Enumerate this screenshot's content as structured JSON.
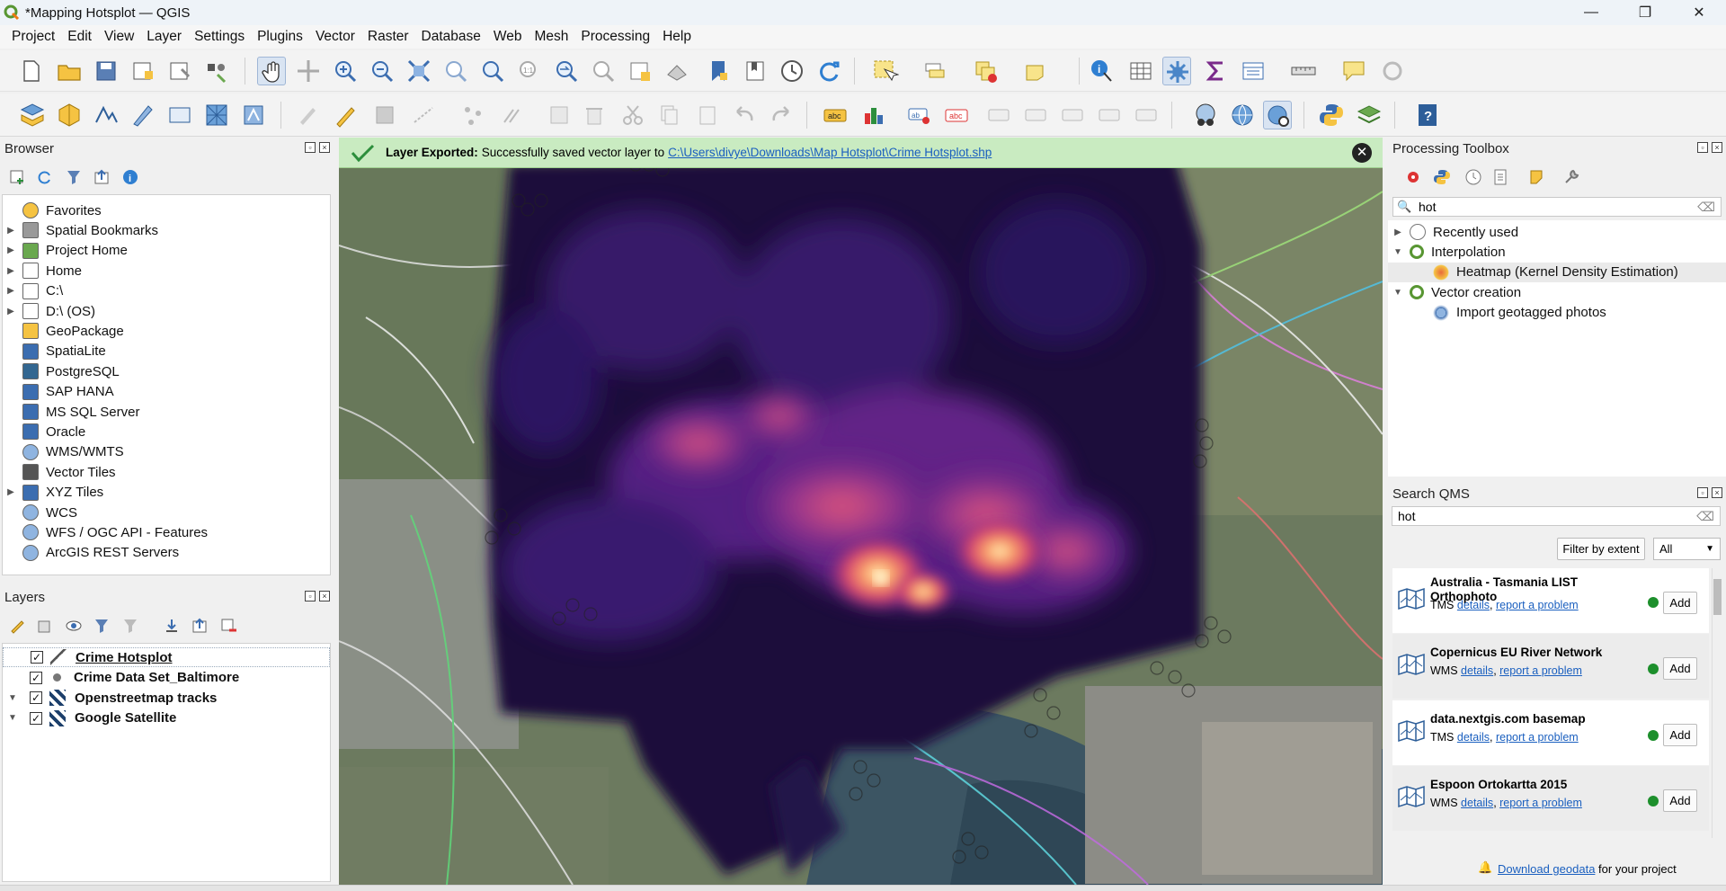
{
  "window": {
    "title": "*Mapping Hotsplot — QGIS",
    "minimize": "—",
    "maximize": "❐",
    "close": "✕"
  },
  "menu": [
    "Project",
    "Edit",
    "View",
    "Layer",
    "Settings",
    "Plugins",
    "Vector",
    "Raster",
    "Database",
    "Web",
    "Mesh",
    "Processing",
    "Help"
  ],
  "browser": {
    "title": "Browser",
    "items": [
      {
        "label": "Favorites",
        "icon": "star-icon",
        "expandable": false
      },
      {
        "label": "Spatial Bookmarks",
        "icon": "bookmark-icon",
        "expandable": true
      },
      {
        "label": "Project Home",
        "icon": "project-home-icon",
        "expandable": true
      },
      {
        "label": "Home",
        "icon": "home-icon",
        "expandable": true
      },
      {
        "label": "C:\\",
        "icon": "drive-icon",
        "expandable": true
      },
      {
        "label": "D:\\ (OS)",
        "icon": "drive-icon",
        "expandable": true
      },
      {
        "label": "GeoPackage",
        "icon": "geopackage-icon",
        "expandable": false
      },
      {
        "label": "SpatiaLite",
        "icon": "spatialite-icon",
        "expandable": false
      },
      {
        "label": "PostgreSQL",
        "icon": "postgresql-icon",
        "expandable": false
      },
      {
        "label": "SAP HANA",
        "icon": "sap-hana-icon",
        "expandable": false
      },
      {
        "label": "MS SQL Server",
        "icon": "mssql-icon",
        "expandable": false
      },
      {
        "label": "Oracle",
        "icon": "oracle-icon",
        "expandable": false
      },
      {
        "label": "WMS/WMTS",
        "icon": "wms-icon",
        "expandable": false
      },
      {
        "label": "Vector Tiles",
        "icon": "vector-tiles-icon",
        "expandable": false
      },
      {
        "label": "XYZ Tiles",
        "icon": "xyz-tiles-icon",
        "expandable": true
      },
      {
        "label": "WCS",
        "icon": "wcs-icon",
        "expandable": false
      },
      {
        "label": "WFS / OGC API - Features",
        "icon": "wfs-icon",
        "expandable": false
      },
      {
        "label": "ArcGIS REST Servers",
        "icon": "arcgis-icon",
        "expandable": false
      }
    ]
  },
  "layers": {
    "title": "Layers",
    "items": [
      {
        "label": "Crime Hotsplot",
        "checked": true,
        "icon": "raster-layer-icon",
        "selected": true,
        "expandable": false
      },
      {
        "label": "Crime Data Set_Baltimore",
        "checked": true,
        "icon": "point-layer-icon",
        "selected": false,
        "expandable": false
      },
      {
        "label": "Openstreetmap tracks",
        "checked": true,
        "icon": "tile-layer-icon",
        "selected": false,
        "expandable": true
      },
      {
        "label": "Google Satellite",
        "checked": true,
        "icon": "tile-layer-icon",
        "selected": false,
        "expandable": true
      }
    ]
  },
  "message": {
    "bold": "Layer Exported:",
    "text": "Successfully saved vector layer to",
    "path": "C:\\Users\\divye\\Downloads\\Map Hotsplot\\Crime Hotsplot.shp"
  },
  "processing": {
    "title": "Processing Toolbox",
    "search_value": "hot",
    "tree": [
      {
        "label": "Recently used",
        "level": 0,
        "icon": "clock-icon",
        "arrow": "▶"
      },
      {
        "label": "Interpolation",
        "level": 0,
        "icon": "qgis-icon",
        "arrow": "▼"
      },
      {
        "label": "Heatmap (Kernel Density Estimation)",
        "level": 1,
        "icon": "heatmap-icon",
        "arrow": ""
      },
      {
        "label": "Vector creation",
        "level": 0,
        "icon": "qgis-icon",
        "arrow": "▼"
      },
      {
        "label": "Import geotagged photos",
        "level": 1,
        "icon": "gear-icon",
        "arrow": ""
      }
    ]
  },
  "qms": {
    "title": "Search QMS",
    "search_value": "hot",
    "filter_button": "Filter by extent",
    "filter_select": "All",
    "items": [
      {
        "name": "Australia - Tasmania LIST Orthophoto",
        "type": "TMS",
        "details": "details",
        "report": "report a problem",
        "add": "Add"
      },
      {
        "name": "Copernicus EU River Network",
        "type": "WMS",
        "details": "details",
        "report": "report a problem",
        "add": "Add"
      },
      {
        "name": "data.nextgis.com basemap",
        "type": "TMS",
        "details": "details",
        "report": "report a problem",
        "add": "Add"
      },
      {
        "name": "Espoon Ortokartta 2015",
        "type": "WMS",
        "details": "details",
        "report": "report a problem",
        "add": "Add"
      }
    ],
    "download_link": "Download geodata",
    "download_suffix": "for your project"
  },
  "colors": {
    "accent": "#1a5fbf",
    "message_bg": "#c9ebc1",
    "status_ok": "#1d8f2c"
  }
}
